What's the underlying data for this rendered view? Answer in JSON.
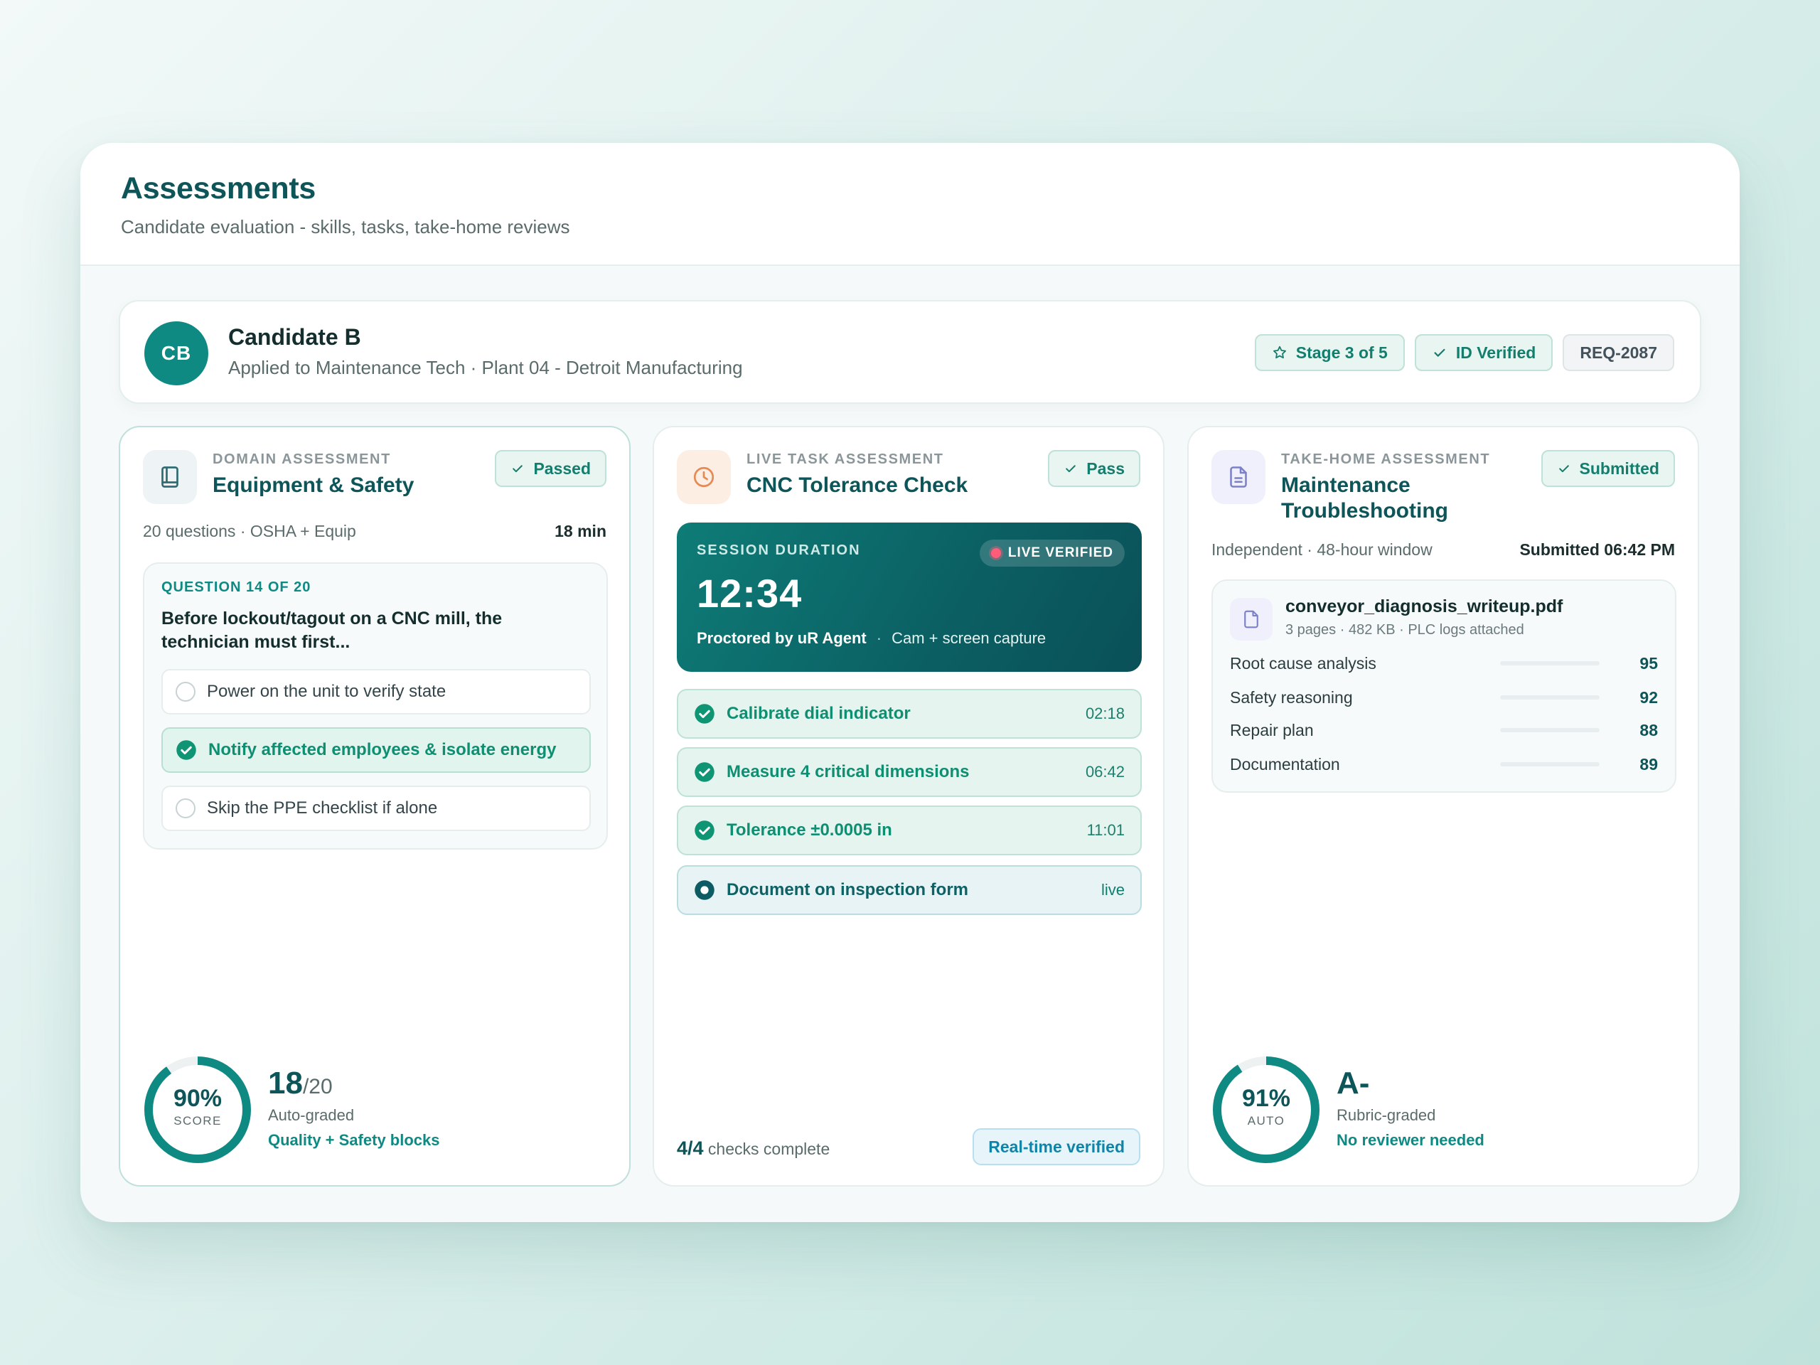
{
  "header": {
    "title": "Assessments",
    "subtitle": "Candidate evaluation - skills, tasks, take-home reviews"
  },
  "candidate": {
    "initials": "CB",
    "name": "Candidate B",
    "applied": "Applied to Maintenance Tech · Plant 04 - Detroit Manufacturing",
    "chips": {
      "stage": "Stage 3 of 5",
      "verified": "ID Verified",
      "req": "REQ-2087"
    }
  },
  "domain": {
    "kicker": "DOMAIN ASSESSMENT",
    "title": "Equipment & Safety",
    "status": "Passed",
    "meta_left": "20 questions · OSHA + Equip",
    "meta_right": "18 min",
    "question": {
      "label": "QUESTION 14 OF 20",
      "text": "Before lockout/tagout on a CNC mill, the technician must first...",
      "options": [
        {
          "text": "Power on the unit to verify state",
          "correct": false
        },
        {
          "text": "Notify affected employees & isolate energy",
          "correct": true
        },
        {
          "text": "Skip the PPE checklist if alone",
          "correct": false
        }
      ]
    },
    "score": {
      "percent": "90%",
      "percent_value": 0.9,
      "ring_label": "SCORE",
      "value": "18",
      "total": "/20",
      "sub": "Auto-graded",
      "note": "Quality + Safety blocks"
    }
  },
  "live": {
    "kicker": "LIVE TASK ASSESSMENT",
    "title": "CNC Tolerance Check",
    "status": "Pass",
    "session": {
      "label": "SESSION DURATION",
      "time": "12:34",
      "badge": "LIVE VERIFIED",
      "proctor": "Proctored by uR Agent",
      "capture": "Cam + screen capture"
    },
    "tasks": [
      {
        "label": "Calibrate dial indicator",
        "time": "02:18",
        "state": "done"
      },
      {
        "label": "Measure 4 critical dimensions",
        "time": "06:42",
        "state": "done"
      },
      {
        "label": "Tolerance ±0.0005 in",
        "time": "11:01",
        "state": "done"
      },
      {
        "label": "Document on inspection form",
        "time": "live",
        "state": "live"
      }
    ],
    "checks_count": "4/4",
    "checks_text": " checks complete",
    "realtime": "Real-time verified"
  },
  "takehome": {
    "kicker": "TAKE-HOME ASSESSMENT",
    "title": "Maintenance Troubleshooting",
    "status": "Submitted",
    "meta_left": "Independent · 48-hour window",
    "meta_right": "Submitted 06:42 PM",
    "file": {
      "name": "conveyor_diagnosis_writeup.pdf",
      "meta": "3 pages · 482 KB · PLC logs attached"
    },
    "rubric": [
      {
        "label": "Root cause analysis",
        "score": "95"
      },
      {
        "label": "Safety reasoning",
        "score": "92"
      },
      {
        "label": "Repair plan",
        "score": "88"
      },
      {
        "label": "Documentation",
        "score": "89"
      }
    ],
    "score": {
      "percent": "91%",
      "percent_value": 0.91,
      "ring_label": "AUTO",
      "grade": "A-",
      "sub": "Rubric-graded",
      "note": "No reviewer needed"
    }
  },
  "colors": {
    "accent": "#0f8a83",
    "success": "#0f8f72",
    "brand_dark": "#0d5558"
  }
}
